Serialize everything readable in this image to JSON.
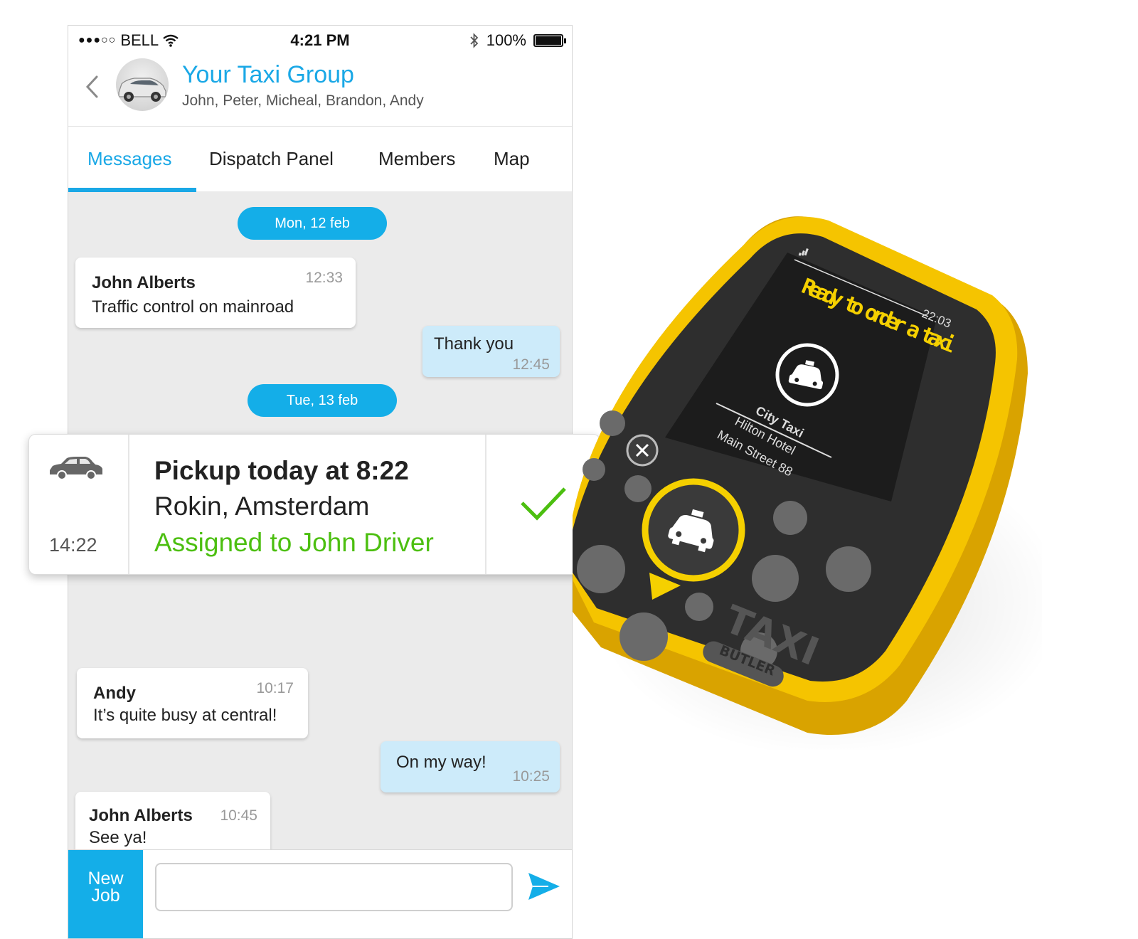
{
  "status_bar": {
    "carrier": "BELL",
    "time": "4:21 PM",
    "battery": "100%"
  },
  "header": {
    "group_name": "Your Taxi Group",
    "members": "John, Peter, Micheal, Brandon, Andy"
  },
  "tabs": [
    {
      "label": "Messages",
      "active": true
    },
    {
      "label": "Dispatch Panel",
      "active": false
    },
    {
      "label": "Members",
      "active": false
    },
    {
      "label": "Map",
      "active": false
    }
  ],
  "dates": [
    "Mon, 12 feb",
    "Tue, 13 feb"
  ],
  "messages": [
    {
      "sender": "John Alberts",
      "text": "Traffic control on mainroad",
      "time": "12:33",
      "direction": "in"
    },
    {
      "text": "Thank you",
      "time": "12:45",
      "direction": "out"
    },
    {
      "sender": "Andy",
      "text": "It’s quite busy at central!",
      "time": "10:17",
      "direction": "in"
    },
    {
      "text": "On my way!",
      "time": "10:25",
      "direction": "out"
    },
    {
      "sender": "John Alberts",
      "text": "See ya!",
      "time": "10:45",
      "direction": "in"
    }
  ],
  "pickup": {
    "time": "14:22",
    "title": "Pickup today at 8:22",
    "location": "Rokin, Amsterdam",
    "status": "Assigned to John Driver",
    "icon": "car-icon",
    "action_icon": "check-icon"
  },
  "composer": {
    "new_job_label": "New Job",
    "placeholder": "",
    "send_icon": "send-icon"
  },
  "device": {
    "screen_time": "22:03",
    "heading": "Ready to order a taxi",
    "company": "City Taxi",
    "address_line1": "Hilton Hotel",
    "address_line2": "Main Street 88",
    "brand": "TAXI",
    "sub_brand": "BUTLER"
  },
  "colors": {
    "accent": "#14aee8",
    "status_green": "#4cbf10",
    "device_yellow": "#f5c400"
  }
}
